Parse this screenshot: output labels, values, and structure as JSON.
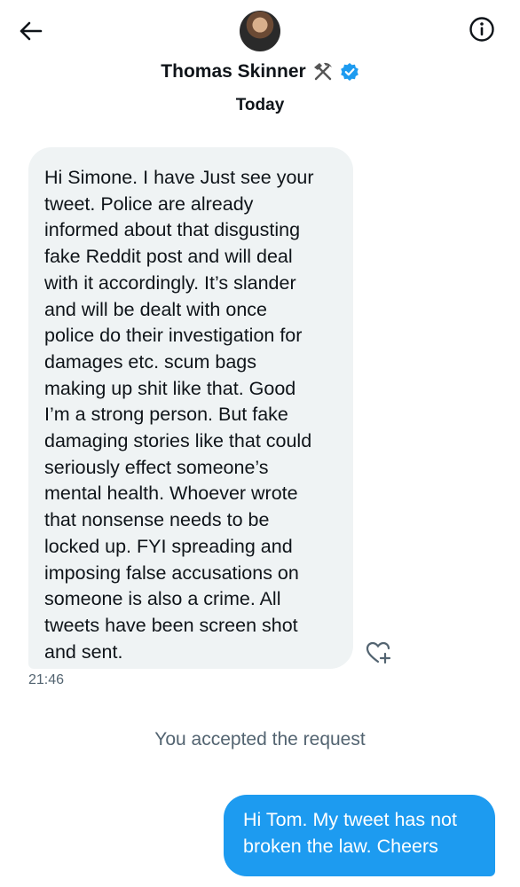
{
  "header": {
    "name": "Thomas Skinner",
    "back_icon": "arrow-left-icon",
    "info_icon": "info-icon",
    "hammer_icon": "hammer-pick-icon",
    "verified_icon": "verified-badge-icon"
  },
  "conversation": {
    "date_divider": "Today",
    "incoming": {
      "text": "Hi Simone. I have Just see your\ntweet. Police are already\ninformed about that disgusting\nfake Reddit post and will deal\nwith it accordingly. It’s slander\nand will be dealt with  once\npolice do their investigation for\ndamages etc. scum bags\nmaking up shit like that. Good\nI’m a strong person. But fake\ndamaging stories like that could\nseriously effect someone’s\nmental health. Whoever wrote\nthat nonsense needs to be\nlocked up. FYI spreading and\nimposing false accusations on\nsomeone is also a crime. All\ntweets have been screen shot\nand sent.",
      "time": "21:46"
    },
    "system_message": "You accepted the request",
    "outgoing": {
      "text": "Hi Tom. My tweet has not\nbroken the law. Cheers"
    }
  },
  "colors": {
    "accent": "#1d9bf0",
    "incoming_bubble": "#eff3f4",
    "secondary_text": "#536471"
  }
}
